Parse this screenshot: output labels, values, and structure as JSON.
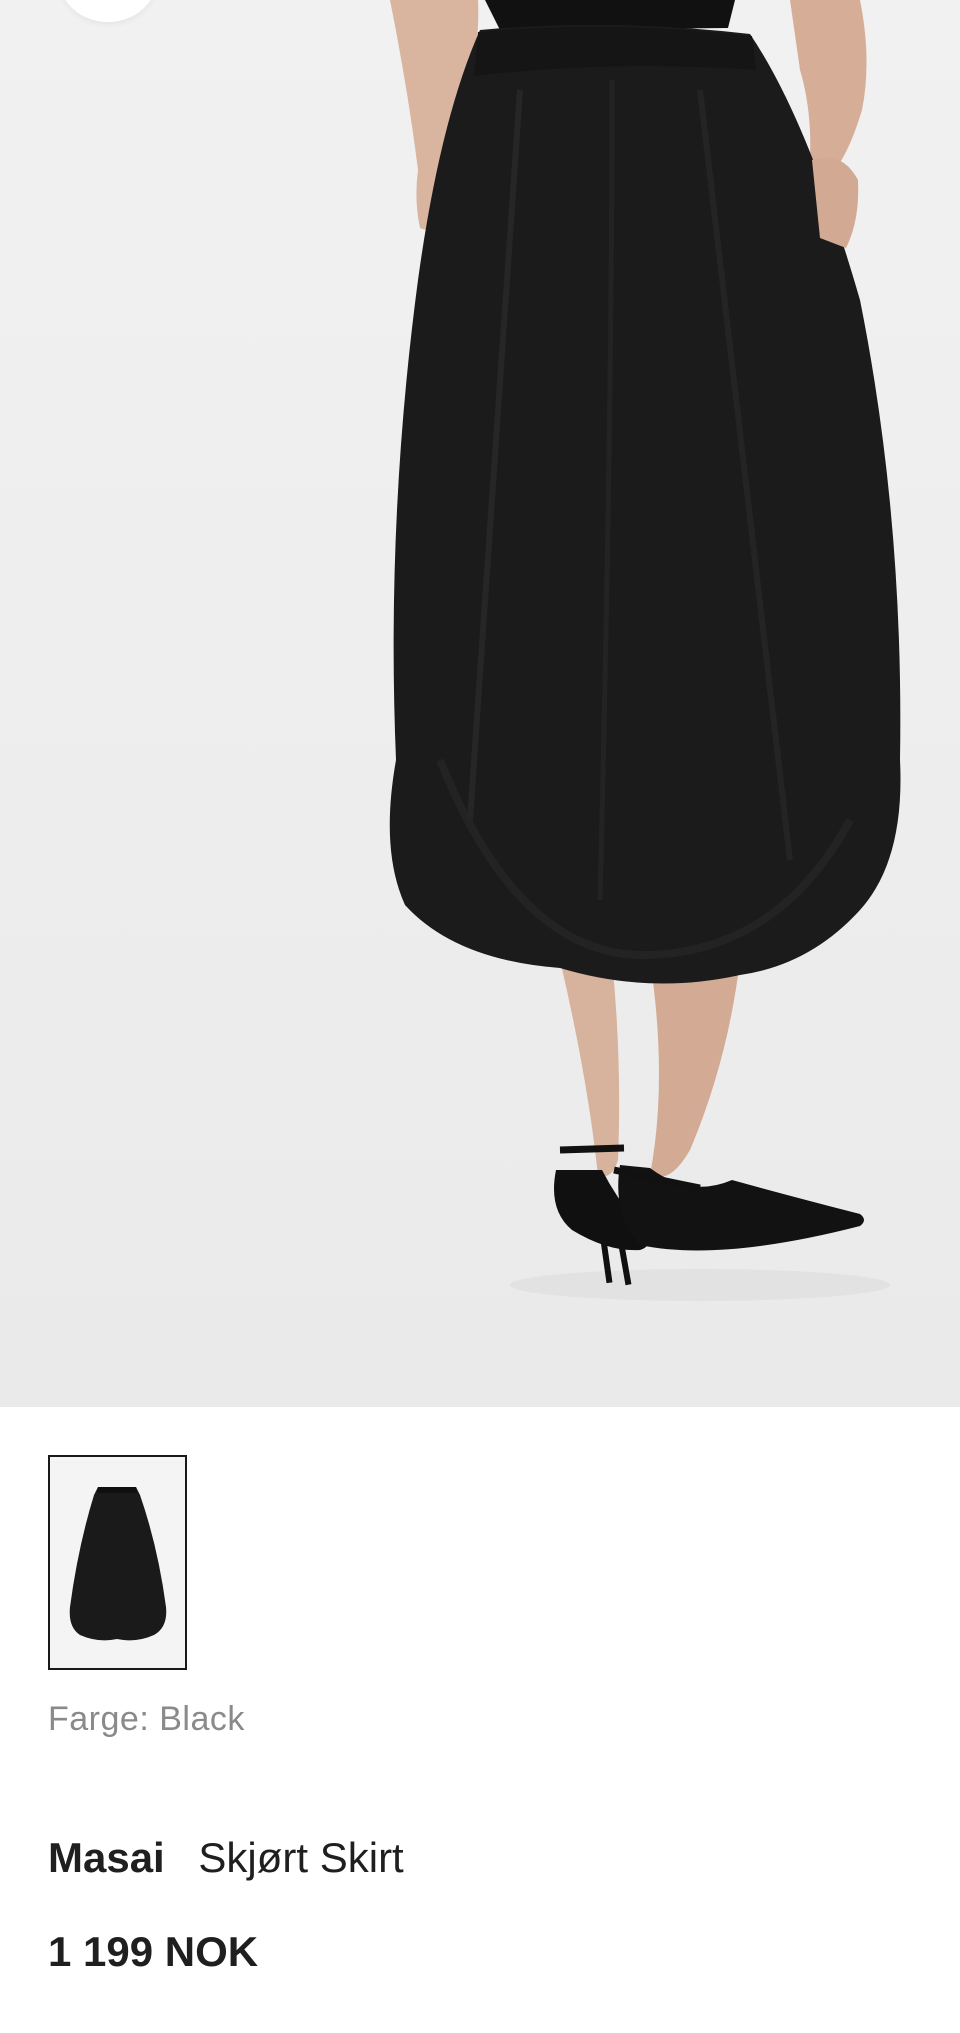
{
  "product": {
    "color_label": "Farge: Black",
    "brand": "Masai",
    "name": "Skjørt Skirt",
    "price": "1 199 NOK"
  },
  "icons": {
    "hero_control": "round-button"
  },
  "colors": {
    "background": "#ffffff",
    "hero_background": "#efefef",
    "skirt": "#1b1b1b",
    "thumbnail_border": "#1a1a1a",
    "muted_text": "#8a8a8a",
    "primary_text": "#1f1f1f"
  }
}
